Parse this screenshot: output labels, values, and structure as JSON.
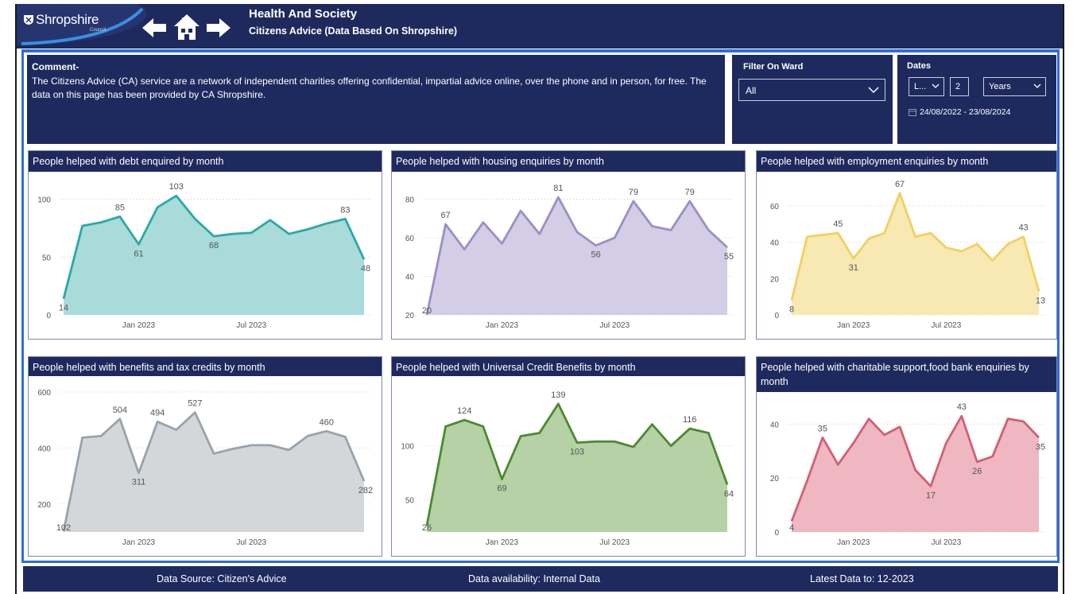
{
  "header": {
    "logo_text": "Shropshire",
    "logo_sub": "Council",
    "title": "Health And Society",
    "subtitle": "Citizens Advice (Data Based On Shropshire)",
    "nav": {
      "back_icon": "arrow-left-icon",
      "home_icon": "home-icon",
      "forward_icon": "arrow-right-icon"
    }
  },
  "comment": {
    "title": "Comment-",
    "body": "The Citizens Advice (CA) service are a network of independent charities offering confidential, impartial advice online, over the phone and in person, for free.  The data on this page has been provided by CA Shropshire."
  },
  "filter": {
    "label": "Filter On Ward",
    "value": "All"
  },
  "dates": {
    "label": "Dates",
    "mode": "L...",
    "number": "2",
    "unit": "Years",
    "range": "24/08/2022 - 23/08/2024"
  },
  "footer": {
    "source": "Data Source:  Citizen's Advice",
    "availability": "Data availability:  Internal Data",
    "latest": "Latest Data to: 12-2023"
  },
  "colors": {
    "navy": "#1e2a5e",
    "border_blue": "#2f6fd6"
  },
  "chart_data": [
    {
      "type": "area",
      "title": "People helped with debt enquired by month",
      "xlabel": "",
      "ylabel": "",
      "x_ticks": [
        "Jan 2023",
        "Jul 2023"
      ],
      "y_ticks": [
        0,
        50,
        100
      ],
      "ylim": [
        0,
        110
      ],
      "values": [
        14,
        77,
        80,
        85,
        61,
        93,
        103,
        83,
        68,
        70,
        71,
        82,
        70,
        74,
        79,
        83,
        48
      ],
      "labels": [
        [
          0,
          "14"
        ],
        [
          3,
          "85"
        ],
        [
          4,
          "61"
        ],
        [
          6,
          "103"
        ],
        [
          8,
          "68"
        ],
        [
          15,
          "83"
        ],
        [
          16,
          "48"
        ]
      ],
      "color": "#2aa9a6",
      "fill": "#a8dbd9",
      "grid": true
    },
    {
      "type": "area",
      "title": "People helped with housing enquiries by month",
      "xlabel": "",
      "ylabel": "",
      "x_ticks": [
        "Jan 2023",
        "Jul 2023"
      ],
      "y_ticks": [
        20,
        40,
        60,
        80
      ],
      "ylim": [
        20,
        86
      ],
      "values": [
        20,
        67,
        54,
        68,
        57,
        74,
        62,
        81,
        63,
        56,
        60,
        79,
        66,
        64,
        79,
        64,
        55
      ],
      "labels": [
        [
          0,
          "20"
        ],
        [
          1,
          "67"
        ],
        [
          7,
          "81"
        ],
        [
          9,
          "56"
        ],
        [
          11,
          "79"
        ],
        [
          14,
          "79"
        ],
        [
          16,
          "55"
        ]
      ],
      "color": "#9b8fc5",
      "fill": "#d3cde5",
      "grid": true
    },
    {
      "type": "area",
      "title": "People helped with employment enquiries by month",
      "xlabel": "",
      "ylabel": "",
      "x_ticks": [
        "Jan 2023",
        "Jul 2023"
      ],
      "y_ticks": [
        0,
        20,
        40,
        60
      ],
      "ylim": [
        0,
        70
      ],
      "values": [
        8,
        43,
        44,
        45,
        31,
        42,
        45,
        67,
        43,
        45,
        37,
        35,
        39,
        30,
        39,
        43,
        13
      ],
      "labels": [
        [
          0,
          "8"
        ],
        [
          3,
          "45"
        ],
        [
          4,
          "31"
        ],
        [
          7,
          "67"
        ],
        [
          15,
          "43"
        ],
        [
          16,
          "13"
        ]
      ],
      "color": "#f2d060",
      "fill": "#f8e8b2",
      "grid": true
    },
    {
      "type": "area",
      "title": "People helped with benefits and tax credits by month",
      "xlabel": "",
      "ylabel": "",
      "x_ticks": [
        "Jan 2023",
        "Jul 2023"
      ],
      "y_ticks": [
        200,
        400,
        600
      ],
      "ylim": [
        100,
        600
      ],
      "values": [
        102,
        437,
        443,
        504,
        311,
        494,
        465,
        527,
        380,
        397,
        410,
        410,
        393,
        443,
        460,
        440,
        282
      ],
      "labels": [
        [
          0,
          "102"
        ],
        [
          3,
          "504"
        ],
        [
          4,
          "311"
        ],
        [
          5,
          "494"
        ],
        [
          7,
          "527"
        ],
        [
          14,
          "460"
        ],
        [
          16,
          "282"
        ]
      ],
      "color": "#98a3ab",
      "fill": "#d3d7da",
      "grid": true
    },
    {
      "type": "area",
      "title": "People helped with Universal Credit Benefits by month",
      "xlabel": "",
      "ylabel": "",
      "x_ticks": [
        "Jan 2023",
        "Jul 2023"
      ],
      "y_ticks": [
        50,
        100
      ],
      "ylim": [
        20,
        150
      ],
      "values": [
        26,
        118,
        124,
        118,
        69,
        109,
        112,
        139,
        103,
        104,
        104,
        99,
        120,
        100,
        116,
        112,
        64
      ],
      "labels": [
        [
          0,
          "26"
        ],
        [
          2,
          "124"
        ],
        [
          4,
          "69"
        ],
        [
          7,
          "139"
        ],
        [
          8,
          "103"
        ],
        [
          14,
          "116"
        ],
        [
          16,
          "64"
        ]
      ],
      "color": "#4b8a2f",
      "fill": "#b5d1a5",
      "grid": true
    },
    {
      "type": "area",
      "title": "People helped with charitable support,food bank enquiries by month",
      "xlabel": "",
      "ylabel": "",
      "x_ticks": [
        "Jan 2023",
        "Jul 2023"
      ],
      "y_ticks": [
        0,
        20,
        40
      ],
      "ylim": [
        0,
        46
      ],
      "values": [
        4,
        19,
        35,
        25,
        33,
        42,
        36,
        39,
        23,
        17,
        33,
        43,
        26,
        28,
        42,
        41,
        35
      ],
      "labels": [
        [
          0,
          "4"
        ],
        [
          2,
          "35"
        ],
        [
          9,
          "17"
        ],
        [
          11,
          "43"
        ],
        [
          12,
          "26"
        ],
        [
          16,
          "35"
        ]
      ],
      "color": "#d35f73",
      "fill": "#eeb7c1",
      "grid": true
    }
  ]
}
